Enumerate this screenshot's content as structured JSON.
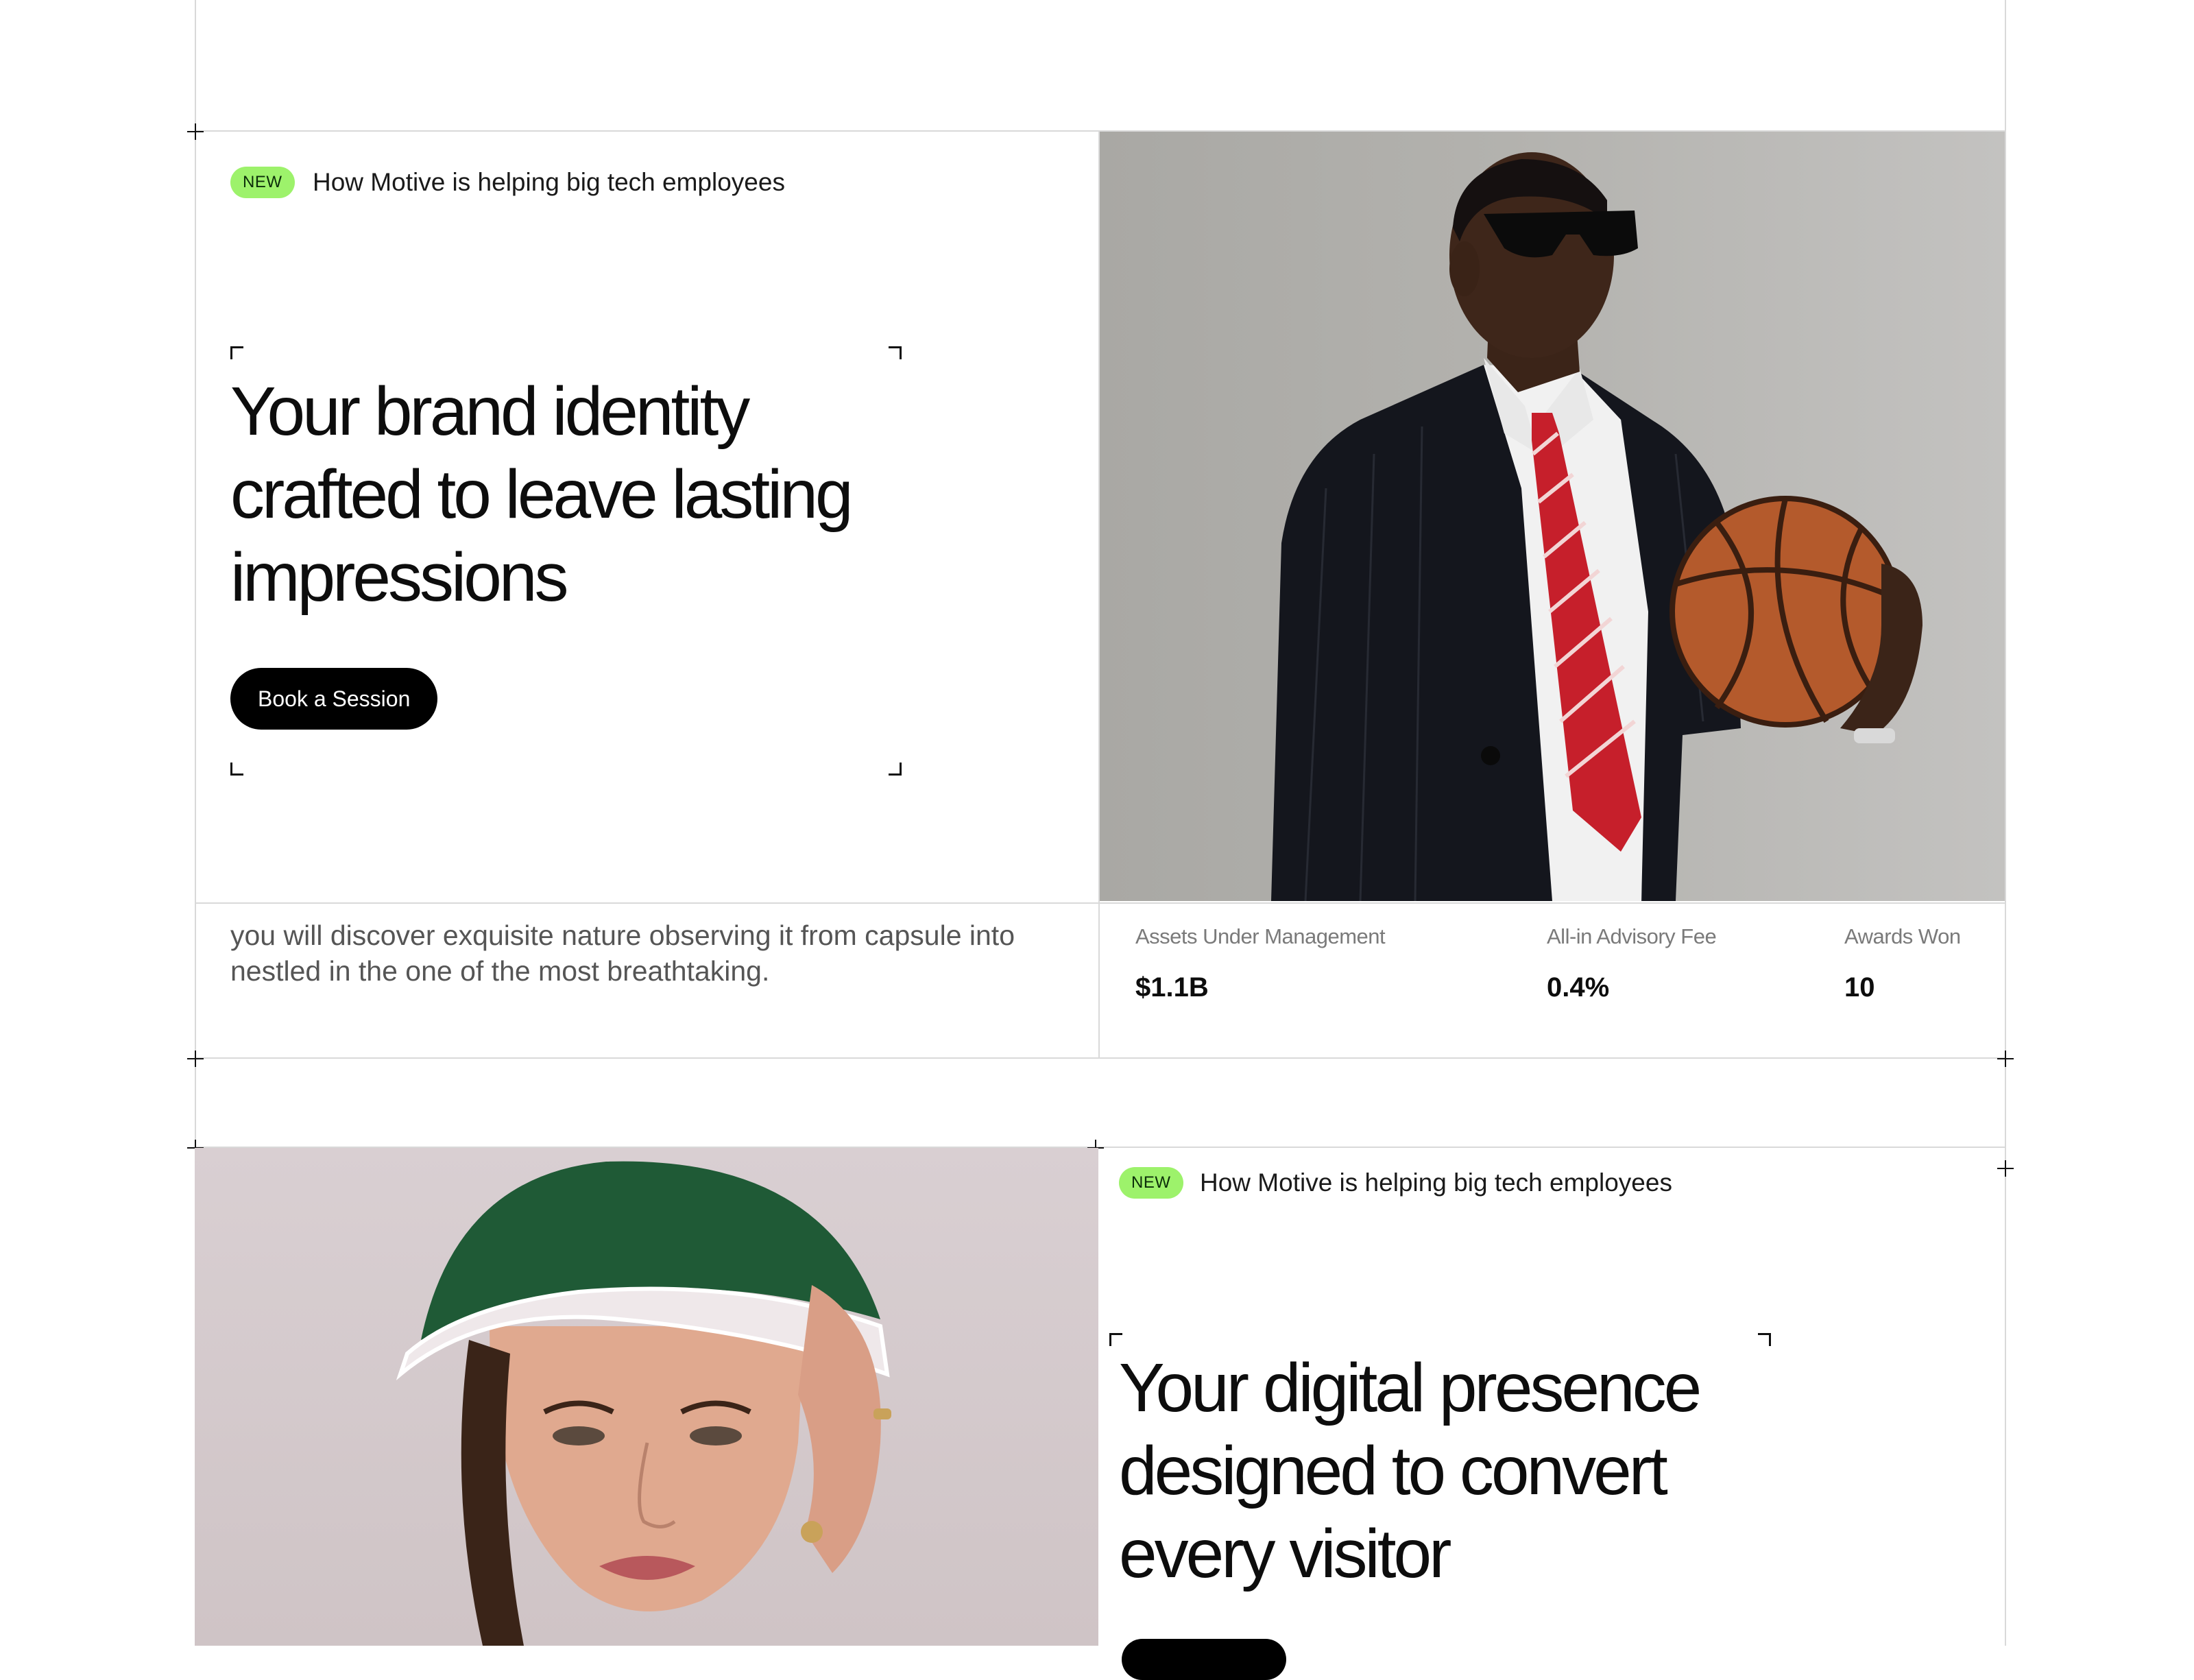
{
  "hero": {
    "badge": "NEW",
    "tagline": "How Motive is helping big tech employees",
    "headline_lines": [
      "Your brand identity",
      "crafted to leave lasting",
      "impressions"
    ],
    "cta_label": "Book a Session",
    "description": "you will discover exquisite nature observing it from capsule into nestled in the one of the most breathtaking.",
    "stats": [
      {
        "label": "Assets Under Management",
        "value": "$1.1B"
      },
      {
        "label": "All-in Advisory Fee",
        "value": "0.4%"
      },
      {
        "label": "Awards Won",
        "value": "10"
      }
    ]
  },
  "section2": {
    "badge": "NEW",
    "tagline": "How Motive is helping big tech employees",
    "headline_lines": [
      "Your digital presence",
      "designed to convert",
      "every visitor"
    ]
  }
}
